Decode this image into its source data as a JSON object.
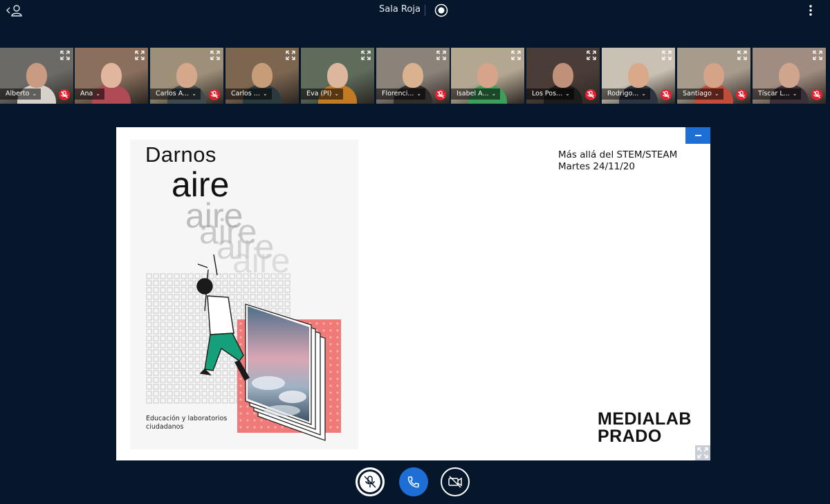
{
  "room": {
    "title": "Sala Roja"
  },
  "participants": [
    {
      "name": "Alberto",
      "muted": true,
      "bg": "#6b6a67",
      "skin": "#c99b83",
      "shirt": "#d6d2cb"
    },
    {
      "name": "Ana",
      "muted": false,
      "bg": "#8a6f5c",
      "skin": "#e0b79e",
      "shirt": "#b04b56"
    },
    {
      "name": "Carlos A...",
      "muted": true,
      "bg": "#9e8f78",
      "skin": "#d5a88c",
      "shirt": "#3f4a4f"
    },
    {
      "name": "Carlos ...",
      "muted": false,
      "bg": "#7d6650",
      "skin": "#c79c79",
      "shirt": "#2a3a3f",
      "active": true
    },
    {
      "name": "Eva (PI)",
      "muted": false,
      "bg": "#5f6c5c",
      "skin": "#dcb69d",
      "shirt": "#c27a25"
    },
    {
      "name": "Florenci...",
      "muted": true,
      "bg": "#8b8279",
      "skin": "#d9b28f",
      "shirt": "#2f2c2b"
    },
    {
      "name": "Isabel A...",
      "muted": false,
      "bg": "#b3a792",
      "skin": "#d5a48a",
      "shirt": "#3aa05a"
    },
    {
      "name": "Los Pos...",
      "muted": true,
      "bg": "#4a3d38",
      "skin": "#c09078",
      "shirt": "#1c1c1c"
    },
    {
      "name": "Rodrigo...",
      "muted": true,
      "bg": "#c9c1b3",
      "skin": "#d9a98a",
      "shirt": "#2d3442"
    },
    {
      "name": "Santiago",
      "muted": true,
      "bg": "#a79b8c",
      "skin": "#d5a387",
      "shirt": "#c04c3a"
    },
    {
      "name": "Tíscar L...",
      "muted": true,
      "bg": "#a08c80",
      "skin": "#d0a58d",
      "shirt": "#3b2f39"
    }
  ],
  "presentation": {
    "topic_line1": "Más allá del STEM/STEAM",
    "topic_line2": "Martes 24/11/20",
    "poster": {
      "title_line1": "Darnos",
      "title_line2": "aire",
      "echo": "aire",
      "caption_line1": "Educación y laboratorios",
      "caption_line2": "ciudadanos"
    },
    "logo_line1": "MEDIALAB",
    "logo_line2": "PRADO"
  },
  "colors": {
    "background": "#06172b",
    "accent": "#1d6fd6",
    "muted_badge": "#e5202e",
    "poster_pink": "#ef7a78",
    "poster_green": "#16a07a"
  }
}
